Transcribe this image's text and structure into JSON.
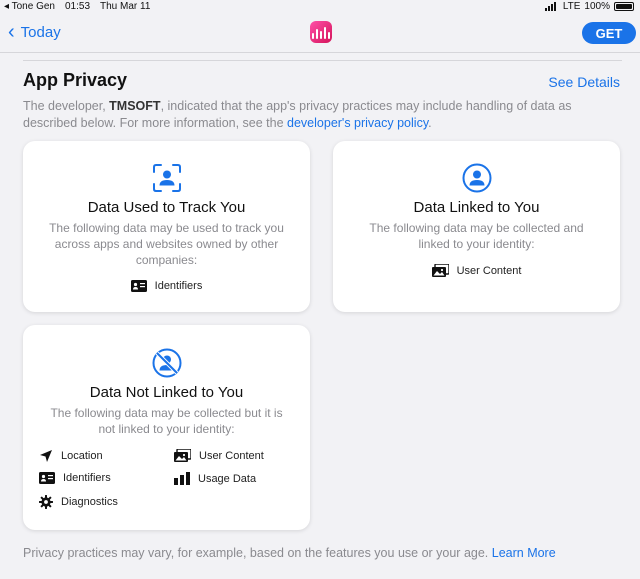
{
  "status": {
    "back_app": "◂ Tone Gen",
    "time": "01:53",
    "date": "Thu Mar 11",
    "network": "LTE",
    "battery": "100%"
  },
  "nav": {
    "back_label": "Today",
    "get_label": "GET"
  },
  "privacy": {
    "title": "App Privacy",
    "see_details": "See Details",
    "intro_prefix": "The developer, ",
    "developer": "TMSOFT",
    "intro_middle": ", indicated that the app's privacy practices may include handling of data as described below. For more information, see the ",
    "policy_link": "developer's privacy policy",
    "intro_suffix": "."
  },
  "cards": {
    "track": {
      "title": "Data Used to Track You",
      "desc": "The following data may be used to track you across apps and websites owned by other companies:",
      "items": [
        "Identifiers"
      ]
    },
    "linked": {
      "title": "Data Linked to You",
      "desc": "The following data may be collected and linked to your identity:",
      "items": [
        "User Content"
      ]
    },
    "not_linked": {
      "title": "Data Not Linked to You",
      "desc": "The following data may be collected but it is not linked to your identity:",
      "items": [
        "Location",
        "User Content",
        "Identifiers",
        "Usage Data",
        "Diagnostics"
      ]
    }
  },
  "footer": {
    "text": "Privacy practices may vary, for example, based on the features you use or your age. ",
    "learn_more": "Learn More"
  },
  "colors": {
    "accent": "#1a73e8",
    "background": "#f2f2f5",
    "app_icon": "#e0247a"
  }
}
